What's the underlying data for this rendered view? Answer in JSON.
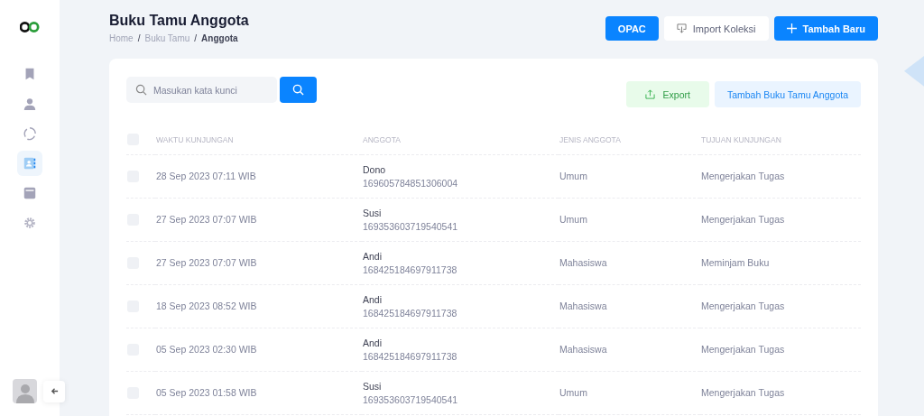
{
  "sidebar": {
    "items": [
      {
        "selected": false
      },
      {
        "selected": false
      },
      {
        "selected": false
      },
      {
        "selected": true
      },
      {
        "selected": false
      },
      {
        "selected": false
      }
    ]
  },
  "header": {
    "title": "Buku Tamu Anggota",
    "breadcrumb": [
      {
        "kind": "link",
        "text": "Home"
      },
      {
        "kind": "separator",
        "text": "/"
      },
      {
        "kind": "link",
        "text": "Buku Tamu"
      },
      {
        "kind": "separator",
        "text": "/"
      },
      {
        "kind": "current",
        "text": "Anggota"
      }
    ],
    "buttons": [
      {
        "kind": "primary",
        "label": "OPAC"
      },
      {
        "kind": "import",
        "label": "Import Koleksi"
      },
      {
        "kind": "add",
        "label": "Tambah Baru"
      }
    ]
  },
  "search": {
    "placeholder": "Masukan kata kunci"
  },
  "actions": [
    {
      "kind": "export",
      "label": "Export"
    },
    {
      "kind": "add",
      "label": "Tambah Buku Tamu Anggota"
    }
  ],
  "table": {
    "select_all_checked": false,
    "columns": [
      "WAKTU KUNJUNGAN",
      "ANGGOTA",
      "JENIS ANGGOTA",
      "TUJUAN KUNJUNGAN"
    ],
    "rows": [
      {
        "checked": false,
        "time": "28 Sep 2023 07:11 WIB",
        "name": "Dono",
        "id": "169605784851306004",
        "type": "Umum",
        "purpose": "Mengerjakan Tugas"
      },
      {
        "checked": false,
        "time": "27 Sep 2023 07:07 WIB",
        "name": "Susi",
        "id": "169353603719540541",
        "type": "Umum",
        "purpose": "Mengerjakan Tugas"
      },
      {
        "checked": false,
        "time": "27 Sep 2023 07:07 WIB",
        "name": "Andi",
        "id": "168425184697911738",
        "type": "Mahasiswa",
        "purpose": "Meminjam Buku"
      },
      {
        "checked": false,
        "time": "18 Sep 2023 08:52 WIB",
        "name": "Andi",
        "id": "168425184697911738",
        "type": "Mahasiswa",
        "purpose": "Mengerjakan Tugas"
      },
      {
        "checked": false,
        "time": "05 Sep 2023 02:30 WIB",
        "name": "Andi",
        "id": "168425184697911738",
        "type": "Mahasiswa",
        "purpose": "Mengerjakan Tugas"
      },
      {
        "checked": false,
        "time": "05 Sep 2023 01:58 WIB",
        "name": "Susi",
        "id": "169353603719540541",
        "type": "Umum",
        "purpose": "Mengerjakan Tugas"
      }
    ]
  }
}
